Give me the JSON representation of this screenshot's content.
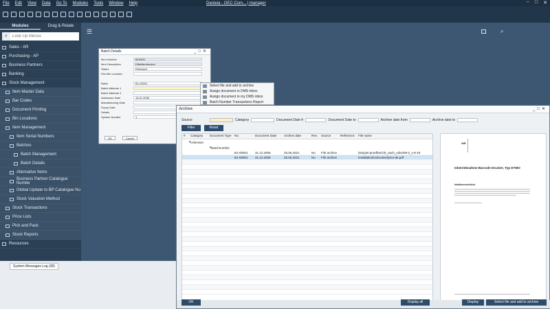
{
  "menubar": {
    "items": [
      "File",
      "Edit",
      "View",
      "Data",
      "Go To",
      "Modules",
      "Tools",
      "Window",
      "Help"
    ],
    "title": "Danieia - OEC Com... | manager",
    "controls": [
      "−",
      "□",
      "✕"
    ]
  },
  "sidebar": {
    "tabs": [
      "Modules",
      "Drag & Relate"
    ],
    "search_placeholder": "Look Up Menus",
    "items": [
      {
        "label": "Sales - AR",
        "level": 0
      },
      {
        "label": "Purchasing - AP",
        "level": 0
      },
      {
        "label": "Business Partners",
        "level": 0
      },
      {
        "label": "Banking",
        "level": 0
      },
      {
        "label": "Stock Management",
        "level": 0
      },
      {
        "label": "Item Master Data",
        "level": 1
      },
      {
        "label": "Bar Codes",
        "level": 1
      },
      {
        "label": "Document Printing",
        "level": 1
      },
      {
        "label": "Bin Locations",
        "level": 1
      },
      {
        "label": "Item Management",
        "level": 1
      },
      {
        "label": "Item Serial Numbers",
        "level": 2
      },
      {
        "label": "Batches",
        "level": 2
      },
      {
        "label": "Batch Management",
        "level": 3
      },
      {
        "label": "Batch Details",
        "level": 3
      },
      {
        "label": "Alternative Items",
        "level": 2
      },
      {
        "label": "Business Partner Catalogue Numbe",
        "level": 2
      },
      {
        "label": "Global Update to BP Catalogue Nu",
        "level": 2
      },
      {
        "label": "Stock Valuation Method",
        "level": 2
      },
      {
        "label": "Stock Transactions",
        "level": 1
      },
      {
        "label": "Price Lists",
        "level": 1
      },
      {
        "label": "Pick and Pack",
        "level": 1
      },
      {
        "label": "Stock Reports",
        "level": 1
      },
      {
        "label": "Resources",
        "level": 0
      }
    ]
  },
  "status": {
    "tab": "System Messages Log (38)"
  },
  "batch": {
    "title": "Batch Details",
    "fields": [
      {
        "label": "Item Number",
        "value": "B10000",
        "style": "gray"
      },
      {
        "label": "Item Description",
        "value": "Etikettendrucker",
        "style": "gray"
      },
      {
        "label": "Status",
        "value": "Released",
        "style": "normal"
      },
      {
        "label": "First Bin Location",
        "value": "",
        "style": "normal"
      },
      {
        "label": "",
        "value": "",
        "style": "none"
      },
      {
        "label": "Batch",
        "value": "B1-00001",
        "style": "normal"
      },
      {
        "label": "Batch Attribute 1",
        "value": "",
        "style": "hl"
      },
      {
        "label": "Batch Attribute 2",
        "value": "",
        "style": "normal"
      },
      {
        "label": "Admission Date",
        "value": "16.01.2006",
        "style": "normal"
      },
      {
        "label": "Manufacturing Date",
        "value": "",
        "style": "normal"
      },
      {
        "label": "Expiry Date",
        "value": "",
        "style": "normal"
      },
      {
        "label": "Details",
        "value": "",
        "style": "normal"
      },
      {
        "label": "System Number",
        "value": "1",
        "style": "normal"
      }
    ],
    "ok": "OK",
    "cancel": "Cancel"
  },
  "context_menu": [
    "Select file and add to archive",
    "Assign document in DMS inbox",
    "Assign document in my DMS inbox",
    "Batch Number Transactions Report"
  ],
  "archive": {
    "title": "Archive",
    "filters": {
      "source": "Source",
      "category": "Category",
      "date_from": "Document Date fr",
      "date_to": "Document Date to",
      "archive_from": "Archive date from",
      "archive_to": "Archive date to"
    },
    "filter_btn": "Filter",
    "reset_btn": "Reset",
    "columns": [
      "#",
      "Category",
      "Document Type",
      "No.",
      "Document Date",
      "Archive date",
      "Rev.",
      "Source",
      "Reference",
      "File name"
    ],
    "group1": "Unknown",
    "group2": "Batchnumber",
    "rows": [
      {
        "no": "B1-00001",
        "doc_date": "31.12.2006",
        "arch_date": "25.05.2021",
        "rev": "No",
        "source": "File archive",
        "ref": "",
        "file": "beispiel-pruefbericht_nach_vdi4208-2_v-8-19"
      },
      {
        "no": "B1-00001",
        "doc_date": "31.12.2006",
        "arch_date": "25.05.2021",
        "rev": "No",
        "source": "File archive",
        "ref": "",
        "file": "installationbcdruckerdymo-de.pdf"
      }
    ],
    "preview": {
      "logo": "AIE",
      "doc_title": "Inbetriebnahme Barcode Drucker, Typ DYMO",
      "toc": "Inhaltsverzeichnis"
    },
    "ok": "OK",
    "display_all": "Display all",
    "display": "Display",
    "select_add": "Select file and add to archive"
  }
}
